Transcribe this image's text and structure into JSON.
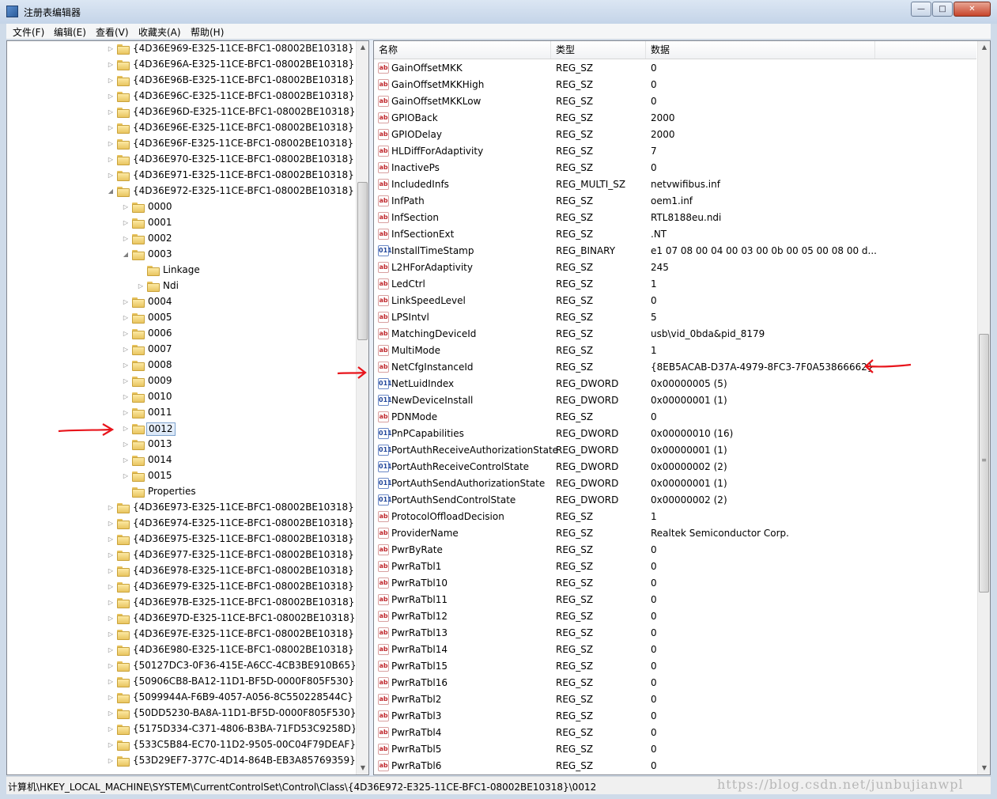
{
  "window": {
    "title": "注册表编辑器"
  },
  "menu": [
    {
      "label": "文件(F)"
    },
    {
      "label": "编辑(E)"
    },
    {
      "label": "查看(V)"
    },
    {
      "label": "收藏夹(A)"
    },
    {
      "label": "帮助(H)"
    }
  ],
  "tree": [
    {
      "label": "{4D36E969-E325-11CE-BFC1-08002BE10318}",
      "level": 0,
      "expander": "collapsed"
    },
    {
      "label": "{4D36E96A-E325-11CE-BFC1-08002BE10318}",
      "level": 0,
      "expander": "collapsed"
    },
    {
      "label": "{4D36E96B-E325-11CE-BFC1-08002BE10318}",
      "level": 0,
      "expander": "collapsed"
    },
    {
      "label": "{4D36E96C-E325-11CE-BFC1-08002BE10318}",
      "level": 0,
      "expander": "collapsed"
    },
    {
      "label": "{4D36E96D-E325-11CE-BFC1-08002BE10318}",
      "level": 0,
      "expander": "collapsed"
    },
    {
      "label": "{4D36E96E-E325-11CE-BFC1-08002BE10318}",
      "level": 0,
      "expander": "collapsed"
    },
    {
      "label": "{4D36E96F-E325-11CE-BFC1-08002BE10318}",
      "level": 0,
      "expander": "collapsed"
    },
    {
      "label": "{4D36E970-E325-11CE-BFC1-08002BE10318}",
      "level": 0,
      "expander": "collapsed"
    },
    {
      "label": "{4D36E971-E325-11CE-BFC1-08002BE10318}",
      "level": 0,
      "expander": "collapsed"
    },
    {
      "label": "{4D36E972-E325-11CE-BFC1-08002BE10318}",
      "level": 0,
      "expander": "expanded"
    },
    {
      "label": "0000",
      "level": 1,
      "expander": "collapsed"
    },
    {
      "label": "0001",
      "level": 1,
      "expander": "collapsed"
    },
    {
      "label": "0002",
      "level": 1,
      "expander": "collapsed"
    },
    {
      "label": "0003",
      "level": 1,
      "expander": "expanded"
    },
    {
      "label": "Linkage",
      "level": 2,
      "expander": "none"
    },
    {
      "label": "Ndi",
      "level": 2,
      "expander": "collapsed"
    },
    {
      "label": "0004",
      "level": 1,
      "expander": "collapsed"
    },
    {
      "label": "0005",
      "level": 1,
      "expander": "collapsed"
    },
    {
      "label": "0006",
      "level": 1,
      "expander": "collapsed"
    },
    {
      "label": "0007",
      "level": 1,
      "expander": "collapsed"
    },
    {
      "label": "0008",
      "level": 1,
      "expander": "collapsed"
    },
    {
      "label": "0009",
      "level": 1,
      "expander": "collapsed"
    },
    {
      "label": "0010",
      "level": 1,
      "expander": "collapsed"
    },
    {
      "label": "0011",
      "level": 1,
      "expander": "collapsed"
    },
    {
      "label": "0012",
      "level": 1,
      "expander": "collapsed",
      "selected": true
    },
    {
      "label": "0013",
      "level": 1,
      "expander": "collapsed"
    },
    {
      "label": "0014",
      "level": 1,
      "expander": "collapsed"
    },
    {
      "label": "0015",
      "level": 1,
      "expander": "collapsed"
    },
    {
      "label": "Properties",
      "level": 1,
      "expander": "none"
    },
    {
      "label": "{4D36E973-E325-11CE-BFC1-08002BE10318}",
      "level": 0,
      "expander": "collapsed"
    },
    {
      "label": "{4D36E974-E325-11CE-BFC1-08002BE10318}",
      "level": 0,
      "expander": "collapsed"
    },
    {
      "label": "{4D36E975-E325-11CE-BFC1-08002BE10318}",
      "level": 0,
      "expander": "collapsed"
    },
    {
      "label": "{4D36E977-E325-11CE-BFC1-08002BE10318}",
      "level": 0,
      "expander": "collapsed"
    },
    {
      "label": "{4D36E978-E325-11CE-BFC1-08002BE10318}",
      "level": 0,
      "expander": "collapsed"
    },
    {
      "label": "{4D36E979-E325-11CE-BFC1-08002BE10318}",
      "level": 0,
      "expander": "collapsed"
    },
    {
      "label": "{4D36E97B-E325-11CE-BFC1-08002BE10318}",
      "level": 0,
      "expander": "collapsed"
    },
    {
      "label": "{4D36E97D-E325-11CE-BFC1-08002BE10318}",
      "level": 0,
      "expander": "collapsed"
    },
    {
      "label": "{4D36E97E-E325-11CE-BFC1-08002BE10318}",
      "level": 0,
      "expander": "collapsed"
    },
    {
      "label": "{4D36E980-E325-11CE-BFC1-08002BE10318}",
      "level": 0,
      "expander": "collapsed"
    },
    {
      "label": "{50127DC3-0F36-415E-A6CC-4CB3BE910B65}",
      "level": 0,
      "expander": "collapsed"
    },
    {
      "label": "{50906CB8-BA12-11D1-BF5D-0000F805F530}",
      "level": 0,
      "expander": "collapsed"
    },
    {
      "label": "{5099944A-F6B9-4057-A056-8C550228544C}",
      "level": 0,
      "expander": "collapsed"
    },
    {
      "label": "{50DD5230-BA8A-11D1-BF5D-0000F805F530}",
      "level": 0,
      "expander": "collapsed"
    },
    {
      "label": "{5175D334-C371-4806-B3BA-71FD53C9258D}",
      "level": 0,
      "expander": "collapsed"
    },
    {
      "label": "{533C5B84-EC70-11D2-9505-00C04F79DEAF}",
      "level": 0,
      "expander": "collapsed"
    },
    {
      "label": "{53D29EF7-377C-4D14-864B-EB3A85769359}",
      "level": 0,
      "expander": "collapsed"
    }
  ],
  "columns": {
    "name": "名称",
    "type": "类型",
    "data": "数据"
  },
  "values": [
    {
      "name": "GainOffsetMKK",
      "type": "REG_SZ",
      "data": "0",
      "icon": "str"
    },
    {
      "name": "GainOffsetMKKHigh",
      "type": "REG_SZ",
      "data": "0",
      "icon": "str"
    },
    {
      "name": "GainOffsetMKKLow",
      "type": "REG_SZ",
      "data": "0",
      "icon": "str"
    },
    {
      "name": "GPIOBack",
      "type": "REG_SZ",
      "data": "2000",
      "icon": "str"
    },
    {
      "name": "GPIODelay",
      "type": "REG_SZ",
      "data": "2000",
      "icon": "str"
    },
    {
      "name": "HLDiffForAdaptivity",
      "type": "REG_SZ",
      "data": "7",
      "icon": "str"
    },
    {
      "name": "InactivePs",
      "type": "REG_SZ",
      "data": "0",
      "icon": "str"
    },
    {
      "name": "IncludedInfs",
      "type": "REG_MULTI_SZ",
      "data": "netvwifibus.inf",
      "icon": "str"
    },
    {
      "name": "InfPath",
      "type": "REG_SZ",
      "data": "oem1.inf",
      "icon": "str"
    },
    {
      "name": "InfSection",
      "type": "REG_SZ",
      "data": "RTL8188eu.ndi",
      "icon": "str"
    },
    {
      "name": "InfSectionExt",
      "type": "REG_SZ",
      "data": ".NT",
      "icon": "str"
    },
    {
      "name": "InstallTimeStamp",
      "type": "REG_BINARY",
      "data": "e1 07 08 00 04 00 03 00 0b 00 05 00 08 00 d...",
      "icon": "bin"
    },
    {
      "name": "L2HForAdaptivity",
      "type": "REG_SZ",
      "data": "245",
      "icon": "str"
    },
    {
      "name": "LedCtrl",
      "type": "REG_SZ",
      "data": "1",
      "icon": "str"
    },
    {
      "name": "LinkSpeedLevel",
      "type": "REG_SZ",
      "data": "0",
      "icon": "str"
    },
    {
      "name": "LPSIntvl",
      "type": "REG_SZ",
      "data": "5",
      "icon": "str"
    },
    {
      "name": "MatchingDeviceId",
      "type": "REG_SZ",
      "data": "usb\\vid_0bda&pid_8179",
      "icon": "str"
    },
    {
      "name": "MultiMode",
      "type": "REG_SZ",
      "data": "1",
      "icon": "str"
    },
    {
      "name": "NetCfgInstanceId",
      "type": "REG_SZ",
      "data": "{8EB5ACAB-D37A-4979-8FC3-7F0A53866662}",
      "icon": "str"
    },
    {
      "name": "NetLuidIndex",
      "type": "REG_DWORD",
      "data": "0x00000005 (5)",
      "icon": "bin"
    },
    {
      "name": "NewDeviceInstall",
      "type": "REG_DWORD",
      "data": "0x00000001 (1)",
      "icon": "bin"
    },
    {
      "name": "PDNMode",
      "type": "REG_SZ",
      "data": "0",
      "icon": "str"
    },
    {
      "name": "PnPCapabilities",
      "type": "REG_DWORD",
      "data": "0x00000010 (16)",
      "icon": "bin"
    },
    {
      "name": "PortAuthReceiveAuthorizationState",
      "type": "REG_DWORD",
      "data": "0x00000001 (1)",
      "icon": "bin"
    },
    {
      "name": "PortAuthReceiveControlState",
      "type": "REG_DWORD",
      "data": "0x00000002 (2)",
      "icon": "bin"
    },
    {
      "name": "PortAuthSendAuthorizationState",
      "type": "REG_DWORD",
      "data": "0x00000001 (1)",
      "icon": "bin"
    },
    {
      "name": "PortAuthSendControlState",
      "type": "REG_DWORD",
      "data": "0x00000002 (2)",
      "icon": "bin"
    },
    {
      "name": "ProtocolOffloadDecision",
      "type": "REG_SZ",
      "data": "1",
      "icon": "str"
    },
    {
      "name": "ProviderName",
      "type": "REG_SZ",
      "data": "Realtek Semiconductor Corp.",
      "icon": "str"
    },
    {
      "name": "PwrByRate",
      "type": "REG_SZ",
      "data": "0",
      "icon": "str"
    },
    {
      "name": "PwrRaTbl1",
      "type": "REG_SZ",
      "data": "0",
      "icon": "str"
    },
    {
      "name": "PwrRaTbl10",
      "type": "REG_SZ",
      "data": "0",
      "icon": "str"
    },
    {
      "name": "PwrRaTbl11",
      "type": "REG_SZ",
      "data": "0",
      "icon": "str"
    },
    {
      "name": "PwrRaTbl12",
      "type": "REG_SZ",
      "data": "0",
      "icon": "str"
    },
    {
      "name": "PwrRaTbl13",
      "type": "REG_SZ",
      "data": "0",
      "icon": "str"
    },
    {
      "name": "PwrRaTbl14",
      "type": "REG_SZ",
      "data": "0",
      "icon": "str"
    },
    {
      "name": "PwrRaTbl15",
      "type": "REG_SZ",
      "data": "0",
      "icon": "str"
    },
    {
      "name": "PwrRaTbl16",
      "type": "REG_SZ",
      "data": "0",
      "icon": "str"
    },
    {
      "name": "PwrRaTbl2",
      "type": "REG_SZ",
      "data": "0",
      "icon": "str"
    },
    {
      "name": "PwrRaTbl3",
      "type": "REG_SZ",
      "data": "0",
      "icon": "str"
    },
    {
      "name": "PwrRaTbl4",
      "type": "REG_SZ",
      "data": "0",
      "icon": "str"
    },
    {
      "name": "PwrRaTbl5",
      "type": "REG_SZ",
      "data": "0",
      "icon": "str"
    },
    {
      "name": "PwrRaTbl6",
      "type": "REG_SZ",
      "data": "0",
      "icon": "str"
    }
  ],
  "status": {
    "path": "计算机\\HKEY_LOCAL_MACHINE\\SYSTEM\\CurrentControlSet\\Control\\Class\\{4D36E972-E325-11CE-BFC1-08002BE10318}\\0012"
  },
  "watermark": "https://blog.csdn.net/junbujianwpl",
  "colors": {
    "annotation_arrow": "#e8141b",
    "selection": "#d9e7f8"
  }
}
